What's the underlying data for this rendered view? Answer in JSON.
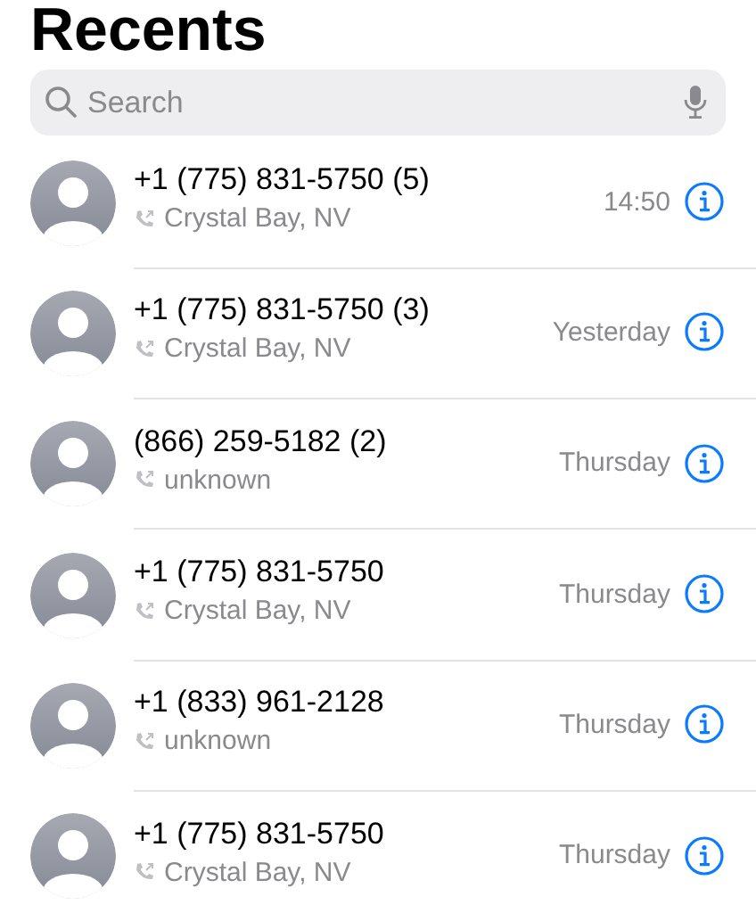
{
  "title": "Recents",
  "search": {
    "placeholder": "Search"
  },
  "calls": [
    {
      "name": "+1 (775) 831-5750 (5)",
      "location": "Crystal Bay, NV",
      "time": "14:50"
    },
    {
      "name": "+1 (775) 831-5750 (3)",
      "location": "Crystal Bay, NV",
      "time": "Yesterday"
    },
    {
      "name": "(866) 259-5182 (2)",
      "location": "unknown",
      "time": "Thursday"
    },
    {
      "name": "+1 (775) 831-5750",
      "location": "Crystal Bay, NV",
      "time": "Thursday"
    },
    {
      "name": "+1 (833) 961-2128",
      "location": "unknown",
      "time": "Thursday"
    },
    {
      "name": "+1 (775) 831-5750",
      "location": "Crystal Bay, NV",
      "time": "Thursday"
    }
  ]
}
